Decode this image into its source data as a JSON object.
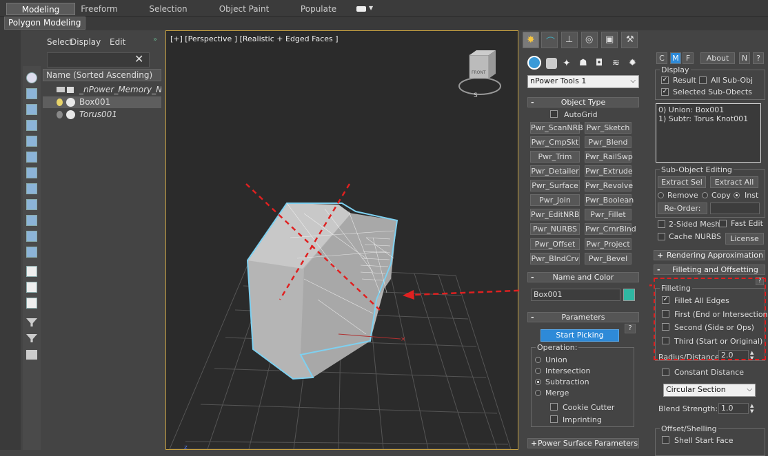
{
  "ribbon": {
    "tabs": [
      "Modeling",
      "Freeform",
      "Selection",
      "Object Paint",
      "Populate"
    ],
    "active": "Modeling",
    "subtab": "Polygon Modeling"
  },
  "explorer": {
    "menu": [
      "Select",
      "Display",
      "Edit"
    ],
    "header": "Name (Sorted Ascending)",
    "rows": [
      "_nPower_Memory_Ne",
      "Box001",
      "Torus001"
    ]
  },
  "viewport": {
    "label": "[+] [Perspective ] [Realistic + Edged Faces ]",
    "viewcube": "FRONT",
    "compass_s": "S",
    "axis_z": "z"
  },
  "create_panel": {
    "dropdown": "nPower Tools 1",
    "object_type": {
      "title": "Object Type",
      "autogrid": "AutoGrid",
      "buttons": [
        "Pwr_ScanNRB",
        "Pwr_Sketch",
        "Pwr_CmpSkt",
        "Pwr_Blend",
        "Pwr_Trim",
        "Pwr_RailSwp",
        "Pwr_Detailer",
        "Pwr_Extrude",
        "Pwr_Surface",
        "Pwr_Revolve",
        "Pwr_Join",
        "Pwr_Boolean",
        "Pwr_EditNRB",
        "Pwr_Fillet",
        "Pwr_NURBS",
        "Pwr_CrnrBlnd",
        "Pwr_Offset",
        "Pwr_Project",
        "Pwr_BlndCrv",
        "Pwr_Bevel"
      ]
    },
    "name_color": {
      "title": "Name and Color",
      "name": "Box001",
      "color": "#2fb7a2"
    },
    "parameters": {
      "title": "Parameters",
      "start_picking": "Start Picking",
      "operation_label": "Operation:",
      "operations": [
        "Union",
        "Intersection",
        "Subtraction",
        "Merge"
      ],
      "selected_operation": "Subtraction",
      "cookie_cutter": "Cookie Cutter",
      "imprinting": "Imprinting"
    },
    "power_surface": "Power Surface Parameters"
  },
  "modify_panel": {
    "top_buttons": [
      "C",
      "M",
      "F",
      "About",
      "N",
      "?"
    ],
    "display": {
      "title": "Display",
      "result": "Result",
      "all_sub_obj": "All Sub-Obj",
      "selected_sub": "Selected Sub-Obects"
    },
    "list": [
      "0) Union: Box001",
      "1) Subtr: Torus Knot001"
    ],
    "sub_object_editing": {
      "title": "Sub-Object Editing",
      "extract_sel": "Extract Sel",
      "extract_all": "Extract All",
      "remove": "Remove",
      "copy": "Copy",
      "inst": "Inst",
      "reorder": "Re-Order:"
    },
    "two_sided": "2-Sided Mesh",
    "fast_edit": "Fast Edit",
    "cache_nurbs": "Cache NURBS",
    "license": "License",
    "rendering_approx": "Rendering Approximation",
    "filleting_offsetting": "Filleting and Offsetting",
    "filleting": {
      "title": "Filleting",
      "fillet_all": "Fillet All Edges",
      "first": "First (End or Intersection)",
      "second": "Second (Side or Ops)",
      "third": "Third (Start or Original)",
      "radius_label": "Radius/Distance:",
      "radius_value": "2.0"
    },
    "constant_distance": "Constant Distance",
    "section": "Circular Section",
    "blend_label": "Blend Strength:",
    "blend_value": "1.0",
    "offset_title": "Offset/Shelling",
    "shell_start": "Shell Start Face"
  }
}
